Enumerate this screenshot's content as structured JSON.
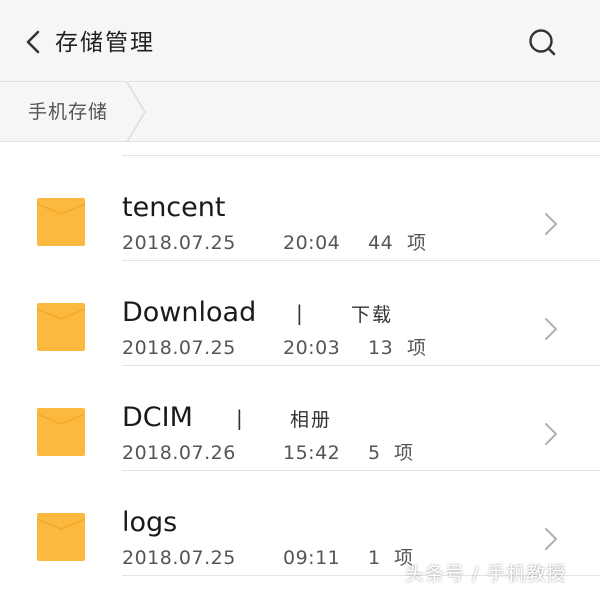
{
  "header": {
    "title": "存储管理",
    "back_icon": "chevron-left-icon",
    "search_icon": "search-icon"
  },
  "breadcrumb": {
    "items": [
      "手机存储"
    ]
  },
  "colors": {
    "folder": "#fbb93f",
    "background": "#ffffff",
    "bar": "#f6f6f6"
  },
  "files": [
    {
      "name": "tencent",
      "alias": "",
      "date": "2018.07.25",
      "time": "20:04",
      "count": "44",
      "unit": "项"
    },
    {
      "name": "Download",
      "alias": "下载",
      "date": "2018.07.25",
      "time": "20:03",
      "count": "13",
      "unit": "项"
    },
    {
      "name": "DCIM",
      "alias": "相册",
      "date": "2018.07.26",
      "time": "15:42",
      "count": "5",
      "unit": "项"
    },
    {
      "name": "logs",
      "alias": "",
      "date": "2018.07.25",
      "time": "09:11",
      "count": "1",
      "unit": "项"
    }
  ],
  "watermark": "头条号 / 手机教授"
}
